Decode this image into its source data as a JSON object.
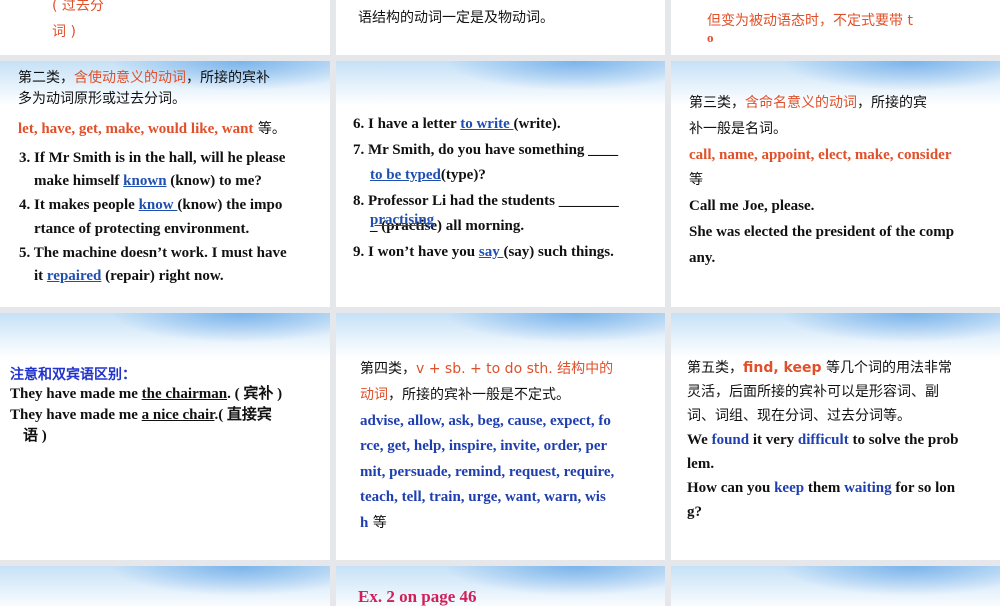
{
  "slides": {
    "s1": {
      "l1": "( 过去分",
      "l2": "词 )"
    },
    "s2": {
      "l1": "语结构的动词一定是及物动词。"
    },
    "s3": {
      "l1": "但变为被动语态时，不定式要带 t",
      "l2": "o"
    },
    "s4": {
      "h1a": "第二类，",
      "h1b": "含使动意义的动词",
      "h1c": "，所接的宾补",
      "h2": "多为动词原形或过去分词。",
      "verbs": "let, have, get, make, would like, want",
      "deng": " 等。",
      "q3a": "3. If Mr Smith is in the hall, will he please",
      "q3b": "make himself ",
      "q3ans": "known",
      "q3c": " (know) to me?",
      "q4a": "4. It makes people ",
      "q4ans": "know ",
      "q4b": " (know) the impo",
      "q4c": "rtance of protecting environment.",
      "q5a": "5. The machine doesn’t work. I must have",
      "q5b": "it ",
      "q5ans": "repaired",
      "q5c": " (repair) right now."
    },
    "s5": {
      "q6a": "6. I have a letter ",
      "q6ans": "to write ",
      "q6b": " (write).",
      "q7a": "7. Mr Smith, do you have something ____",
      "q7ans": "to be typed",
      "q7b": "(type)?",
      "q8a": "8. Professor Li had the students ________",
      "q8ans": "practising",
      "q8b": "_ (practise) all morning.",
      "q9a": "9. I won’t have you ",
      "q9ans": "say ",
      "q9b": " (say) such things."
    },
    "s6": {
      "h1a": "第三类，",
      "h1b": "含命名意义的动词",
      "h1c": "，所接的宾",
      "h2": "补一般是名词。",
      "verbs": "call, name, appoint, elect, make, consider",
      "deng": "等",
      "e1": "Call me Joe, please.",
      "e2": "She was elected the president of the comp",
      "e3": "any."
    },
    "s7": {
      "h": "注意和双宾语区别：",
      "l1a": "They have made me ",
      "l1u": "the chairman",
      "l1b": ". ( 宾补 )",
      "l2a": "They have made me ",
      "l2u": "a nice chair",
      "l2b": ".( 直接宾",
      "l3": "语 )"
    },
    "s8": {
      "h1a": "第四类，",
      "h1b": "v + sb. + to do sth.  结构中的",
      "h2a": "动词",
      "h2b": "，所接的宾补一般是不定式。",
      "v1": "advise, allow, ask, beg, cause, expect, fo",
      "v2": "rce, get, help, inspire, invite, order, per",
      "v3": "mit, persuade, remind, request, require,",
      "v4": " teach, tell, train, urge, want, warn, wis",
      "v5": "h",
      "deng": " 等"
    },
    "s9": {
      "h1a": "第五类，",
      "h1b": "find, keep",
      "h1c": "  等几个词的用法非常",
      "h2": "灵活，后面所接的宾补可以是形容词、副",
      "h3": "词、词组、现在分词、过去分词等。",
      "e1a": "We ",
      "e1b": "found",
      "e1c": " it very ",
      "e1d": "difficult",
      "e1e": " to solve the prob",
      "e2": "lem.",
      "e3a": "How can you ",
      "e3b": "keep",
      "e3c": " them ",
      "e3d": "waiting",
      "e3e": " for so lon",
      "e4": "g?"
    },
    "s11": {
      "title": "Ex. 2 on page 46"
    }
  }
}
